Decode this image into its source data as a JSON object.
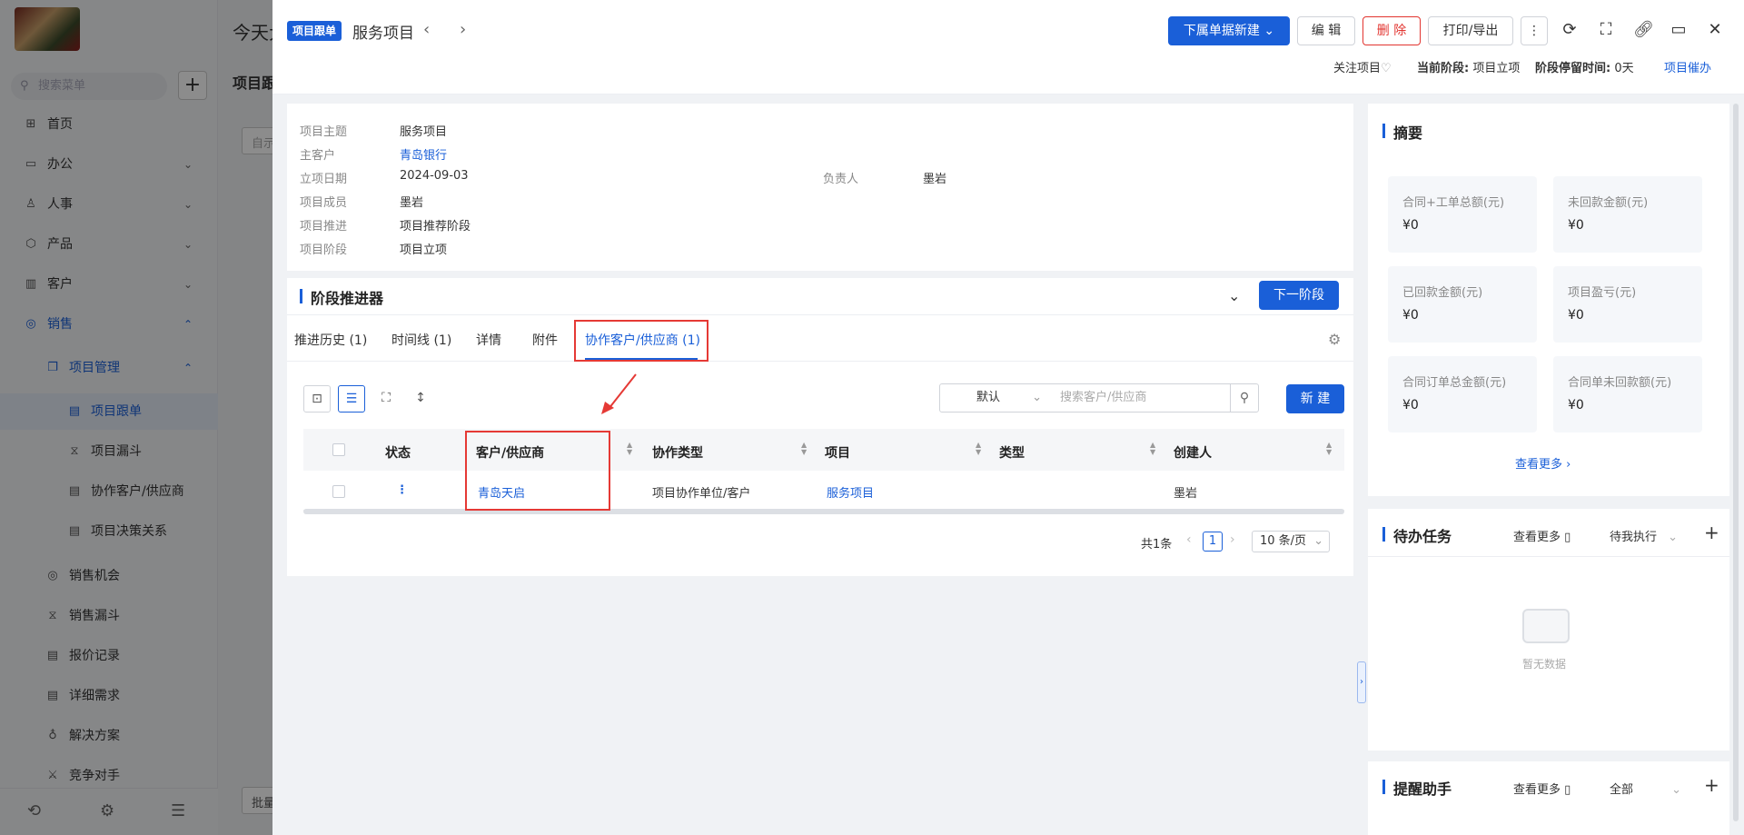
{
  "sidebar": {
    "search_placeholder": "搜索菜单",
    "items": [
      {
        "label": "首页",
        "icon": "home-icon"
      },
      {
        "label": "办公",
        "icon": "office-icon"
      },
      {
        "label": "人事",
        "icon": "people-icon"
      },
      {
        "label": "产品",
        "icon": "product-icon"
      },
      {
        "label": "客户",
        "icon": "customer-icon"
      },
      {
        "label": "销售",
        "icon": "sales-icon"
      },
      {
        "label": "项目管理",
        "icon": "project-icon"
      },
      {
        "label": "项目跟单",
        "icon": "doc-icon"
      },
      {
        "label": "项目漏斗",
        "icon": "funnel-icon"
      },
      {
        "label": "协作客户/供应商",
        "icon": "doc-icon"
      },
      {
        "label": "项目决策关系",
        "icon": "doc-icon"
      },
      {
        "label": "销售机会",
        "icon": "target-icon"
      },
      {
        "label": "销售漏斗",
        "icon": "funnel-icon"
      },
      {
        "label": "报价记录",
        "icon": "doc-icon"
      },
      {
        "label": "详细需求",
        "icon": "doc-icon"
      },
      {
        "label": "解决方案",
        "icon": "bulb-icon"
      },
      {
        "label": "竞争对手",
        "icon": "sword-icon"
      }
    ]
  },
  "behind": {
    "top_text": "今天大",
    "tab_title": "项目跟",
    "field": "自示",
    "bottom_btn": "批量"
  },
  "header": {
    "tag": "项目跟单",
    "title": "服务项目",
    "new_sub_button": "下属单据新建",
    "edit_button": "编 辑",
    "delete_button": "删 除",
    "print_button": "打印/导出",
    "follow_label": "关注项目",
    "stage_label": "当前阶段:",
    "stage_value": "项目立项",
    "stay_label": "阶段停留时间:",
    "stay_value": "0天",
    "urge_link": "项目催办"
  },
  "info": {
    "fields": [
      {
        "label": "项目主题",
        "value": "服务项目"
      },
      {
        "label": "主客户",
        "value": "青岛银行"
      },
      {
        "label": "立项日期",
        "value": "2024-09-03"
      },
      {
        "label": "项目成员",
        "value": "墨岩"
      },
      {
        "label": "项目推进",
        "value": "项目推荐阶段"
      },
      {
        "label": "项目阶段",
        "value": "项目立项"
      }
    ],
    "owner_label": "负责人",
    "owner_value": "墨岩"
  },
  "stage": {
    "title": "阶段推进器",
    "next_button": "下一阶段",
    "tabs": [
      "推进历史 (1)",
      "时间线 (1)",
      "详情",
      "附件",
      "协作客户/供应商 (1)"
    ],
    "active_tab": 4
  },
  "table": {
    "filter_select": "默认",
    "search_placeholder": "搜索客户/供应商",
    "new_button": "新 建",
    "columns": [
      "状态",
      "客户/供应商",
      "协作类型",
      "项目",
      "类型",
      "创建人"
    ],
    "rows": [
      {
        "status": "⋮",
        "customer": "青岛天启",
        "collab_type": "项目协作单位/客户",
        "project": "服务项目",
        "type": "",
        "creator": "墨岩"
      }
    ],
    "total": "共1条",
    "page": "1",
    "page_size": "10 条/页"
  },
  "summary": {
    "title": "摘要",
    "stats": [
      {
        "label": "合同+工单总额(元)",
        "value": "¥0"
      },
      {
        "label": "未回款金额(元)",
        "value": "¥0"
      },
      {
        "label": "已回款金额(元)",
        "value": "¥0"
      },
      {
        "label": "项目盈亏(元)",
        "value": "¥0"
      },
      {
        "label": "合同订单总金额(元)",
        "value": "¥0"
      },
      {
        "label": "合同单未回款额(元)",
        "value": "¥0"
      }
    ],
    "more_link": "查看更多"
  },
  "todo": {
    "title": "待办任务",
    "more": "查看更多",
    "filter": "待我执行",
    "empty": "暂无数据"
  },
  "reminder": {
    "title": "提醒助手",
    "more": "查看更多",
    "filter": "全部"
  },
  "colors": {
    "primary": "#1a5fd8",
    "danger": "#e2342f",
    "highlight_box": "#e53935"
  }
}
